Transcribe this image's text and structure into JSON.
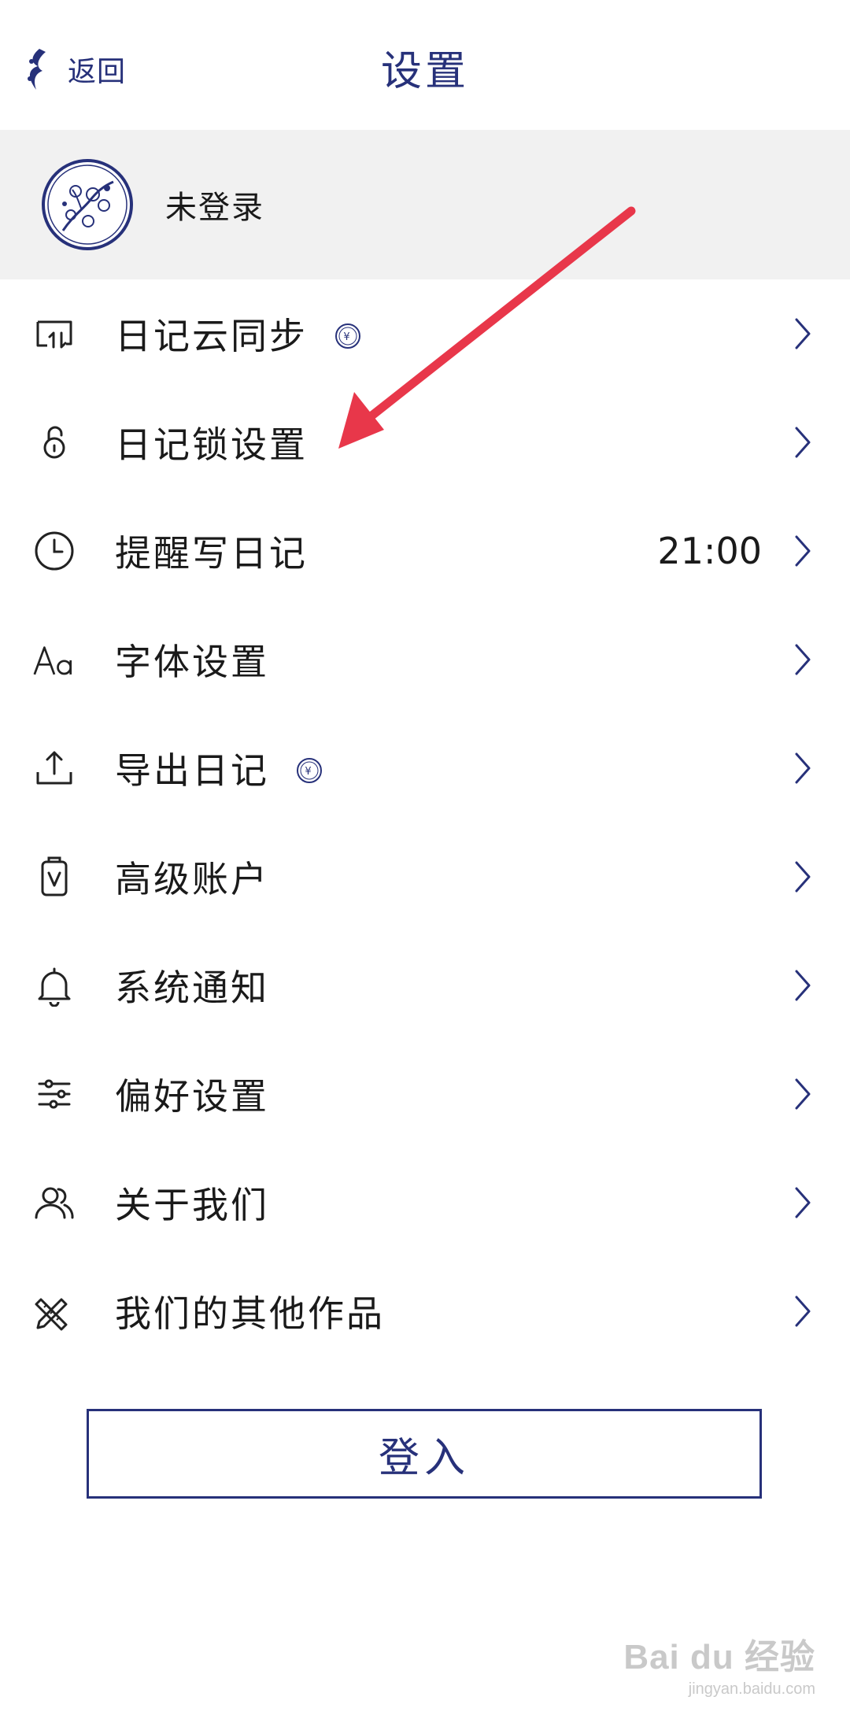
{
  "header": {
    "back_label": "返回",
    "title": "设置"
  },
  "account": {
    "name": "未登录"
  },
  "menu": [
    {
      "label": "日记云同步",
      "icon": "cloud-sync-icon",
      "premium": true,
      "value": ""
    },
    {
      "label": "日记锁设置",
      "icon": "lock-icon",
      "premium": false,
      "value": ""
    },
    {
      "label": "提醒写日记",
      "icon": "clock-icon",
      "premium": false,
      "value": "21:00"
    },
    {
      "label": "字体设置",
      "icon": "font-icon",
      "premium": false,
      "value": ""
    },
    {
      "label": "导出日记",
      "icon": "export-icon",
      "premium": true,
      "value": ""
    },
    {
      "label": "高级账户",
      "icon": "premium-badge-icon",
      "premium": false,
      "value": ""
    },
    {
      "label": "系统通知",
      "icon": "bell-icon",
      "premium": false,
      "value": ""
    },
    {
      "label": "偏好设置",
      "icon": "sliders-icon",
      "premium": false,
      "value": ""
    },
    {
      "label": "关于我们",
      "icon": "people-icon",
      "premium": false,
      "value": ""
    },
    {
      "label": "我们的其他作品",
      "icon": "pencil-ruler-icon",
      "premium": false,
      "value": ""
    }
  ],
  "premium_symbol": "¥",
  "login_button": "登入",
  "watermark": {
    "logo": "Bai du 经验",
    "url": "jingyan.baidu.com"
  },
  "colors": {
    "accent": "#27317a",
    "account_bg": "#f1f1f1",
    "annotation_arrow": "#e8374a",
    "text": "#1a1a1a"
  }
}
